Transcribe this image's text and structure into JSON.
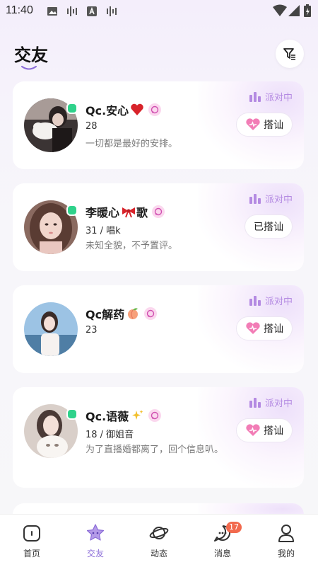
{
  "status_bar": {
    "time": "11:40"
  },
  "header": {
    "title": "交友"
  },
  "party_label": "派对中",
  "users": [
    {
      "name": "Qc.安心",
      "meta": "28",
      "bio": "一切都是最好的安排。",
      "greet_label": "搭讪",
      "greeted": false,
      "online": true,
      "name_emoji": "heart-emoji"
    },
    {
      "name": "李暖心",
      "name_suffix": "歌",
      "meta": "31 / 唱k",
      "bio": "未知全貌，不予置评。",
      "greet_label": "已搭讪",
      "greeted": true,
      "online": true,
      "name_emoji": "bow-emoji"
    },
    {
      "name": "Qc解药",
      "meta": "23",
      "bio": "",
      "greet_label": "搭讪",
      "greeted": false,
      "online": false,
      "name_emoji": "peach-emoji"
    },
    {
      "name": "Qc.语薇",
      "meta": "18 / 御姐音",
      "bio": "为了直播婚都离了，回个信息叭。",
      "greet_label": "搭讪",
      "greeted": false,
      "online": true,
      "name_emoji": "sparkles-emoji"
    }
  ],
  "nav": {
    "items": [
      {
        "label": "首页",
        "icon": "home-icon"
      },
      {
        "label": "交友",
        "icon": "star-icon",
        "active": true
      },
      {
        "label": "动态",
        "icon": "planet-icon"
      },
      {
        "label": "消息",
        "icon": "chat-bubble-icon",
        "badge": "17"
      },
      {
        "label": "我的",
        "icon": "person-icon"
      }
    ]
  },
  "colors": {
    "accent": "#8b6cd8",
    "online": "#2fd28b",
    "badge": "#f26a4e",
    "party": "#b48ae2"
  }
}
